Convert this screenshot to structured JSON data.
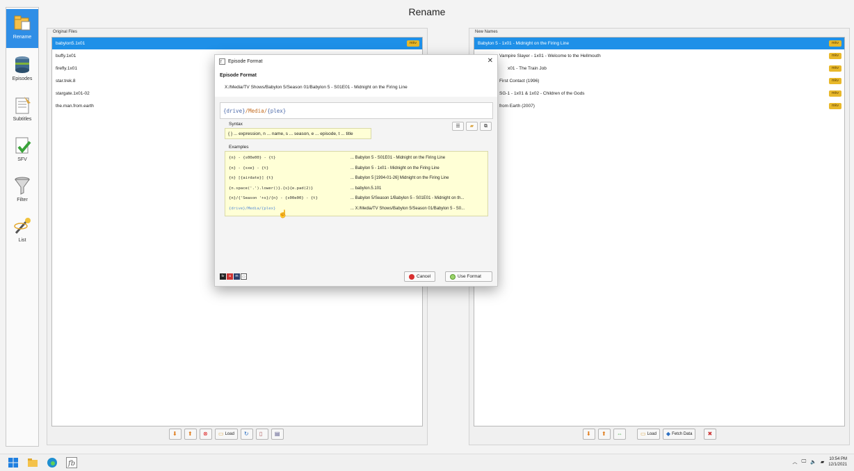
{
  "app": {
    "title": "Rename"
  },
  "sidebar": {
    "items": [
      {
        "label": "Rename",
        "icon": "rename-icon",
        "active": true
      },
      {
        "label": "Episodes",
        "icon": "episodes-icon"
      },
      {
        "label": "Subtitles",
        "icon": "subtitles-icon"
      },
      {
        "label": "SFV",
        "icon": "sfv-icon"
      },
      {
        "label": "Filter",
        "icon": "filter-icon"
      },
      {
        "label": "List",
        "icon": "list-icon"
      }
    ]
  },
  "original": {
    "title": "Original Files",
    "rows": [
      {
        "name": "babylon5.1x01",
        "badge": "mkv"
      },
      {
        "name": "buffy.1x01",
        "badge": ""
      },
      {
        "name": "firefly.1x01",
        "badge": ""
      },
      {
        "name": "star.trek.8",
        "badge": ""
      },
      {
        "name": "stargate.1x01-02",
        "badge": ""
      },
      {
        "name": "the.man.from.earth",
        "badge": ""
      }
    ],
    "toolbar": {
      "load": "Load"
    }
  },
  "new_names": {
    "title": "New Names",
    "rows": [
      {
        "name": "Babylon 5 - 1x01 - Midnight on the Firing Line",
        "badge": "mkv"
      },
      {
        "name": "Vampire Slayer - 1x01 - Welcome to the Hellmouth",
        "badge": "mkv"
      },
      {
        "name": "x01 - The Train Job",
        "badge": "mkv"
      },
      {
        "name": "First Contact (1996)",
        "badge": "mkv"
      },
      {
        "name": "SG-1 - 1x01 & 1x02 - Children of the Gods",
        "badge": "mkv"
      },
      {
        "name": "from Earth (2007)",
        "badge": "mkv"
      }
    ],
    "toolbar": {
      "load": "Load",
      "fetch": "Fetch Data"
    }
  },
  "dialog": {
    "window_title": "Episode Format",
    "heading": "Episode Format",
    "preview": "X:/Media/TV Shows/Babylon 5/Season 01/Babylon 5 - S01E01 - Midnight on the Firing Line",
    "format": {
      "p1": "{drive}",
      "p2": "/Media/",
      "p3": "{plex}"
    },
    "syntax_label": "Syntax",
    "syntax_text": "{ } ... expression, n ... name, s ... season, e ... episode, t ... title",
    "examples_label": "Examples",
    "examples": [
      {
        "code": "{n} - {s00e00} - {t}",
        "out": "... Babylon 5 - S01E01 - Midnight on the Firing Line"
      },
      {
        "code": "{n} - {sxe} - {t}",
        "out": "... Babylon 5 - 1x01 - Midnight on the Firing Line"
      },
      {
        "code": "{n} [{airdate}] {t}",
        "out": "... Babylon 5 [1994-01-26] Midnight on the Firing Line"
      },
      {
        "code": "{n.space('.').lower()}.{s}{e.pad(2)}",
        "out": "... babylon.5.101"
      },
      {
        "code": "{n}/{'Season '+s}/{n} - {s00e00} - {t}",
        "out": "... Babylon 5/Season 1/Babylon 5 - S01E01 - Midnight on th..."
      },
      {
        "code": "{drive}/Media/{plex}",
        "out": "... X:/Media/TV Shows/Babylon 5/Season 01/Babylon 5 - S0..."
      }
    ],
    "cancel": "Cancel",
    "use": "Use Format"
  },
  "taskbar": {
    "time": "10:54 PM",
    "date": "12/1/2021"
  },
  "colors": {
    "accent": "#1e90e8",
    "badge": "#e8b82a",
    "hint_bg": "#ffffd6"
  }
}
